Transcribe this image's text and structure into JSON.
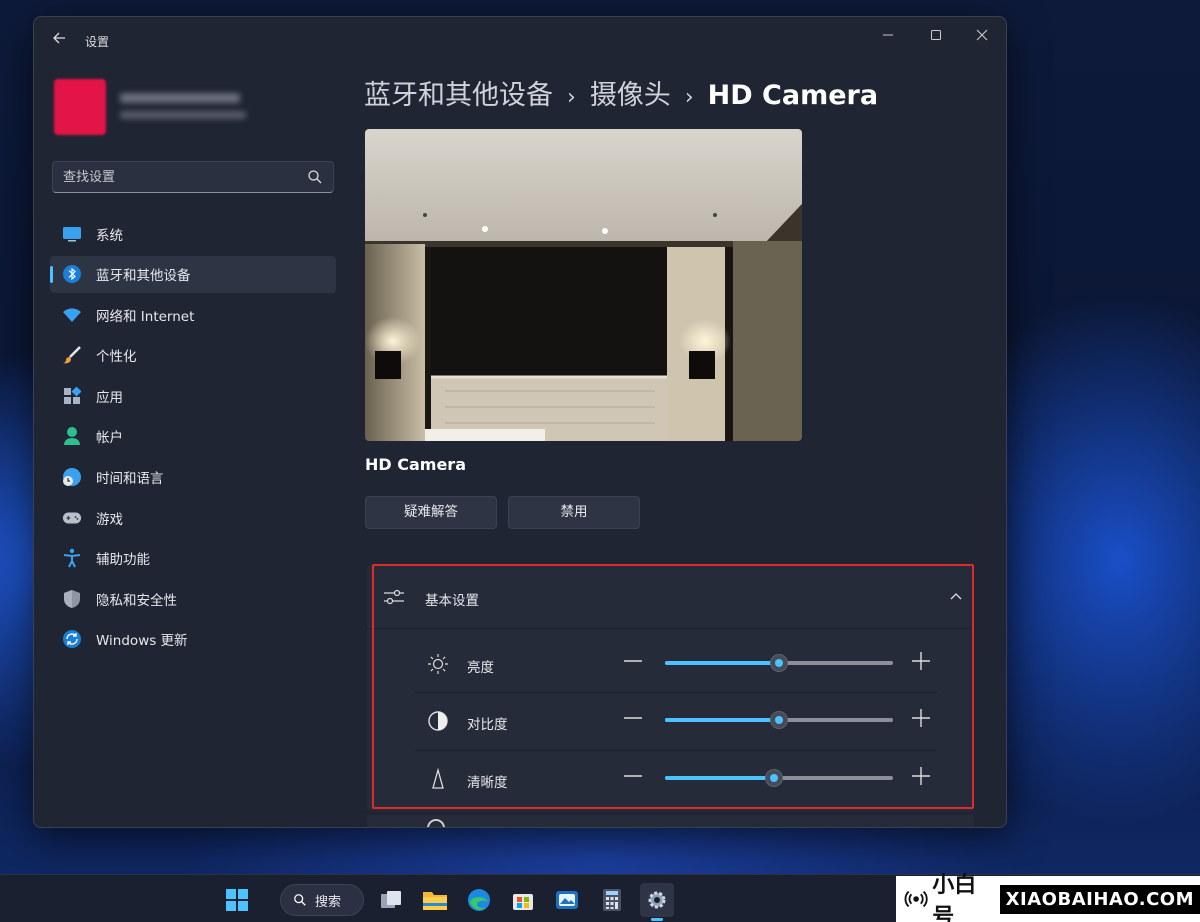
{
  "window": {
    "app_title": "设置",
    "controls": {
      "minimize": "—",
      "maximize": "☐",
      "close": "✕"
    }
  },
  "search": {
    "placeholder": "查找设置"
  },
  "sidebar": {
    "items": [
      {
        "label": "系统",
        "icon": "monitor-icon"
      },
      {
        "label": "蓝牙和其他设备",
        "icon": "bluetooth-icon",
        "active": true
      },
      {
        "label": "网络和 Internet",
        "icon": "wifi-icon"
      },
      {
        "label": "个性化",
        "icon": "paintbrush-icon"
      },
      {
        "label": "应用",
        "icon": "apps-icon"
      },
      {
        "label": "帐户",
        "icon": "person-icon"
      },
      {
        "label": "时间和语言",
        "icon": "clock-globe-icon"
      },
      {
        "label": "游戏",
        "icon": "gamepad-icon"
      },
      {
        "label": "辅助功能",
        "icon": "accessibility-icon"
      },
      {
        "label": "隐私和安全性",
        "icon": "shield-icon"
      },
      {
        "label": "Windows 更新",
        "icon": "update-icon"
      }
    ]
  },
  "breadcrumb": {
    "items": [
      "蓝牙和其他设备",
      "摄像头",
      "HD Camera"
    ],
    "separator": "›"
  },
  "camera": {
    "name": "HD Camera",
    "buttons": {
      "troubleshoot": "疑难解答",
      "disable": "禁用"
    }
  },
  "basic_settings": {
    "title": "基本设置",
    "rows": [
      {
        "label": "亮度",
        "icon": "sun-icon",
        "value": 0.5
      },
      {
        "label": "对比度",
        "icon": "contrast-icon",
        "value": 0.5
      },
      {
        "label": "清晰度",
        "icon": "sharpness-icon",
        "value": 0.48
      }
    ]
  },
  "taskbar": {
    "search_label": "搜索",
    "apps": [
      "start-icon",
      "search-icon",
      "task-view-icon",
      "file-explorer-icon",
      "edge-icon",
      "store-icon",
      "photos-icon",
      "calculator-icon",
      "settings-icon"
    ]
  },
  "watermark": {
    "cn": "小白号",
    "en": "XIAOBAIHAO.COM"
  },
  "colors": {
    "accent": "#4cc2ff",
    "highlight": "#e02a2a"
  }
}
